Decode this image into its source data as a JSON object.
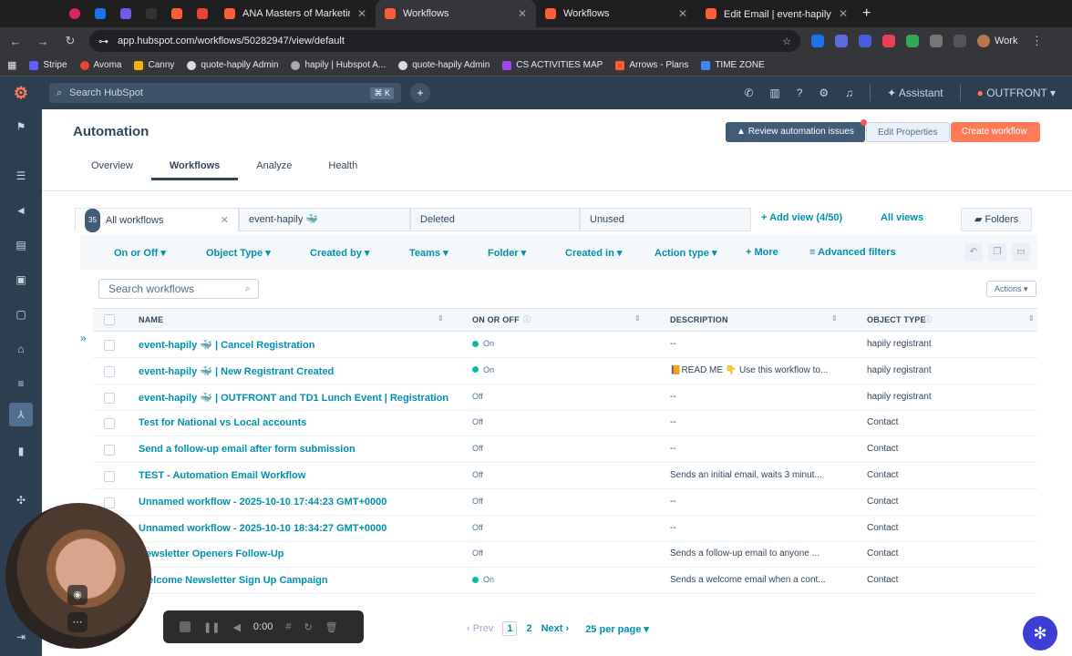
{
  "browser": {
    "tabs": [
      {
        "label": "ANA Masters of Marketing",
        "active": false
      },
      {
        "label": "Workflows",
        "active": true
      },
      {
        "label": "Workflows",
        "active": false
      },
      {
        "label": "Edit Email | event-hapily 🐳 |",
        "active": false
      }
    ],
    "url": "app.hubspot.com/workflows/50282947/view/default",
    "profile": "Work",
    "bookmarks": [
      "Stripe",
      "Avoma",
      "Canny",
      "quote-hapily Admin",
      "hapily | Hubspot A...",
      "quote-hapily Admin",
      "CS ACTIVITIES MAP",
      "Arrows - Plans",
      "TIME ZONE"
    ]
  },
  "hubspot_nav": {
    "search_placeholder": "Search HubSpot",
    "kbd": "⌘ K",
    "assistant": "Assistant",
    "account": "OUTFRONT"
  },
  "page": {
    "title": "Automation",
    "tabs": [
      "Overview",
      "Workflows",
      "Analyze",
      "Health"
    ],
    "active_tab": "Workflows",
    "buttons": {
      "review": "Review automation issues",
      "edit": "Edit Properties",
      "create": "Create workflow ▾"
    }
  },
  "views": {
    "tabs": [
      {
        "label": "All workflows",
        "count": "35"
      },
      {
        "label": "event-hapily 🐳"
      },
      {
        "label": "Deleted"
      },
      {
        "label": "Unused"
      }
    ],
    "add_view": "+ Add view (4/50)",
    "all_views": "All views",
    "folders": "Folders"
  },
  "filters": [
    "On or Off ▾",
    "Object Type ▾",
    "Created by ▾",
    "Teams ▾",
    "Folder ▾",
    "Created in ▾",
    "Action type ▾",
    "+ More",
    "≡ Advanced filters"
  ],
  "table": {
    "search_placeholder": "Search workflows",
    "actions": "Actions ▾",
    "columns": [
      "NAME",
      "ON OR OFF",
      "DESCRIPTION",
      "OBJECT TYPE"
    ],
    "rows": [
      {
        "name": "event-hapily 🐳 | Cancel Registration",
        "status": "On",
        "desc": "--",
        "type": "hapily registrant"
      },
      {
        "name": "event-hapily 🐳 | New Registrant Created",
        "status": "On",
        "desc": "📙READ ME 👇 Use this workflow to...",
        "type": "hapily registrant"
      },
      {
        "name": "event-hapily 🐳 | OUTFRONT and TD1 Lunch Event | Registration",
        "status": "Off",
        "desc": "--",
        "type": "hapily registrant"
      },
      {
        "name": "Test for National vs Local accounts",
        "status": "Off",
        "desc": "--",
        "type": "Contact"
      },
      {
        "name": "Send a follow-up email after form submission",
        "status": "Off",
        "desc": "--",
        "type": "Contact"
      },
      {
        "name": "TEST - Automation Email Workflow",
        "status": "Off",
        "desc": "Sends an initial email, waits 3 minut...",
        "type": "Contact"
      },
      {
        "name": "Unnamed workflow - 2025-10-10 17:44:23 GMT+0000",
        "status": "Off",
        "desc": "--",
        "type": "Contact"
      },
      {
        "name": "Unnamed workflow - 2025-10-10 18:34:27 GMT+0000",
        "status": "Off",
        "desc": "--",
        "type": "Contact"
      },
      {
        "name": "Newsletter Openers Follow-Up",
        "status": "Off",
        "desc": "Sends a follow-up email to anyone ...",
        "type": "Contact"
      },
      {
        "name": "Welcome Newsletter Sign Up Campaign",
        "status": "On",
        "desc": "Sends a welcome email when a cont...",
        "type": "Contact"
      }
    ]
  },
  "pagination": {
    "prev": "Prev",
    "current": "1",
    "next_page": "2",
    "next": "Next",
    "per_page": "25 per page ▾"
  },
  "recorder": {
    "time": "0:00"
  }
}
